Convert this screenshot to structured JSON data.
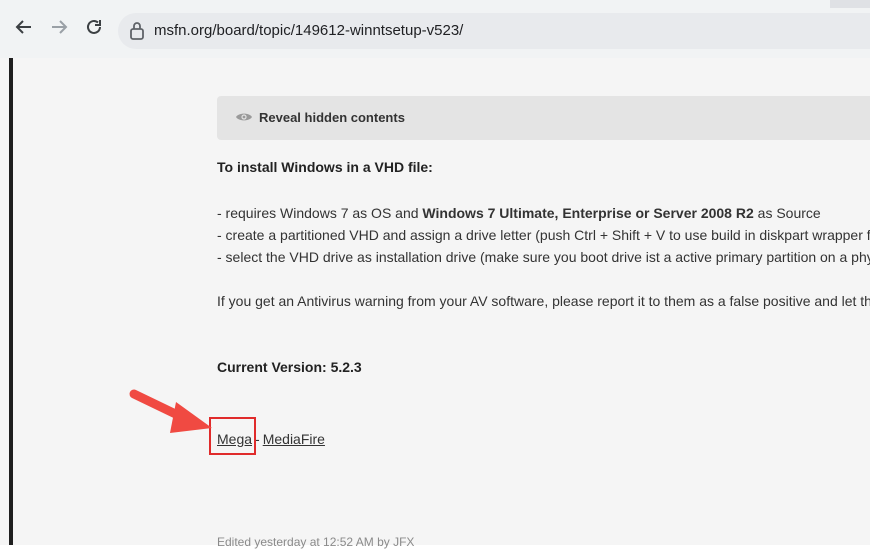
{
  "browser": {
    "url": "msfn.org/board/topic/149612-winntsetup-v523/",
    "back_icon": "arrow-left-icon",
    "forward_icon": "arrow-right-icon",
    "reload_icon": "reload-icon",
    "lock_icon": "lock-icon"
  },
  "post": {
    "reveal_label": "Reveal hidden contents",
    "heading": "To install Windows in a VHD file:",
    "req_prefix": "- requires Windows 7 as OS and ",
    "req_bold": "Windows 7 Ultimate, Enterprise or Server 2008 R2",
    "req_suffix": " as Source",
    "line2": "- create a partitioned VHD and assign a drive letter (push Ctrl + Shift + V to use build in diskpart wrapper fo",
    "line3": "- select the VHD drive as installation drive (make sure you boot drive ist a active primary partition on a phys",
    "antivirus": "If you get an Antivirus warning from your AV software, please report it to them as a false positive and let the",
    "version": "Current Version: 5.2.3",
    "link_mega": "Mega",
    "separator": "-",
    "link_mediafire": "MediaFire",
    "edited": "Edited yesterday at 12:52 AM by JFX"
  },
  "annotation": {
    "arrow_color": "#f04a42",
    "box_color": "#e02b2b"
  }
}
